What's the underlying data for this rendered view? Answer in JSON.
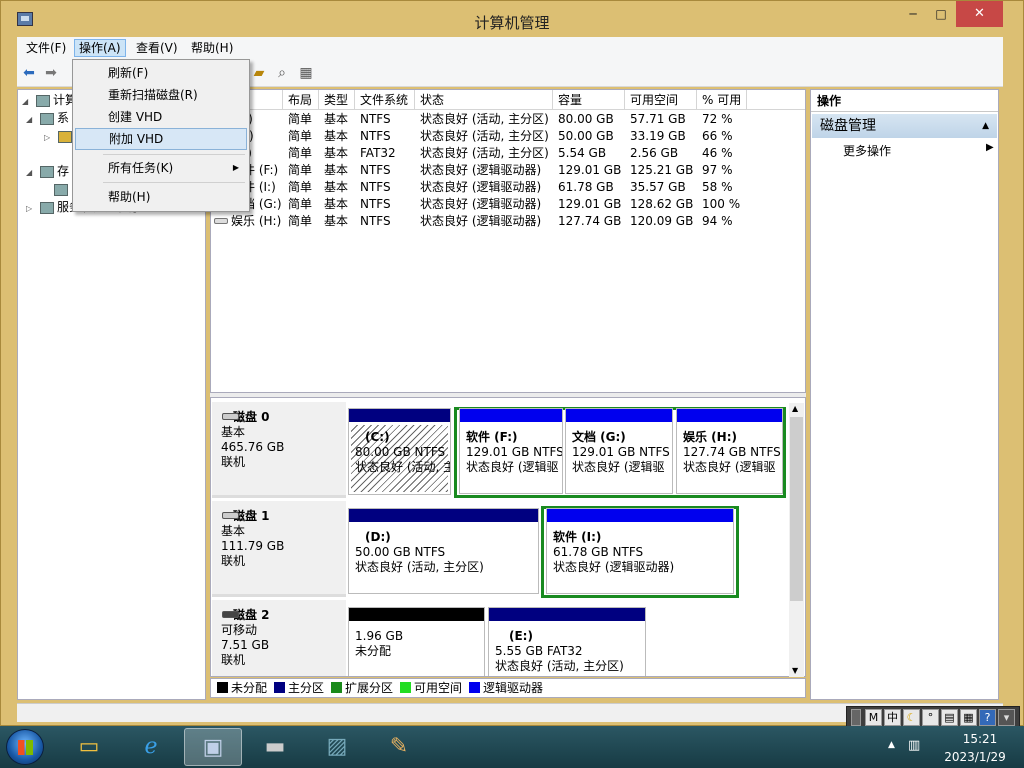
{
  "window": {
    "title": "计算机管理",
    "min": "─",
    "max": "□",
    "close": "✕"
  },
  "menubar": [
    "文件(F)",
    "操作(A)",
    "查看(V)",
    "帮助(H)"
  ],
  "dropdown": {
    "items": [
      "刷新(F)",
      "重新扫描磁盘(R)",
      "创建 VHD",
      "附加 VHD",
      "所有任务(K)",
      "帮助(H)"
    ],
    "highlighted": "附加 VHD",
    "submenu_arrow": "▶"
  },
  "tree": {
    "root": "计算机",
    "items": [
      "系",
      "",
      "存",
      "",
      "服务和应用程序"
    ]
  },
  "volumes": {
    "headers": [
      "卷",
      "布局",
      "类型",
      "文件系统",
      "状态",
      "容量",
      "可用空间",
      "% 可用"
    ],
    "rows": [
      [
        "(C:)",
        "简单",
        "基本",
        "NTFS",
        "状态良好 (活动, 主分区)",
        "80.00 GB",
        "57.71 GB",
        "72 %"
      ],
      [
        "(D:)",
        "简单",
        "基本",
        "NTFS",
        "状态良好 (活动, 主分区)",
        "50.00 GB",
        "33.19 GB",
        "66 %"
      ],
      [
        "(E:)",
        "简单",
        "基本",
        "FAT32",
        "状态良好 (活动, 主分区)",
        "5.54 GB",
        "2.56 GB",
        "46 %"
      ],
      [
        "软件 (F:)",
        "简单",
        "基本",
        "NTFS",
        "状态良好 (逻辑驱动器)",
        "129.01 GB",
        "125.21 GB",
        "97 %"
      ],
      [
        "软件 (I:)",
        "简单",
        "基本",
        "NTFS",
        "状态良好 (逻辑驱动器)",
        "61.78 GB",
        "35.57 GB",
        "58 %"
      ],
      [
        "文档 (G:)",
        "简单",
        "基本",
        "NTFS",
        "状态良好 (逻辑驱动器)",
        "129.01 GB",
        "128.62 GB",
        "100 %"
      ],
      [
        "娱乐 (H:)",
        "简单",
        "基本",
        "NTFS",
        "状态良好 (逻辑驱动器)",
        "127.74 GB",
        "120.09 GB",
        "94 %"
      ]
    ]
  },
  "disks": [
    {
      "name": "磁盘 0",
      "type": "基本",
      "size": "465.76 GB",
      "state": "联机"
    },
    {
      "name": "磁盘 1",
      "type": "基本",
      "size": "111.79 GB",
      "state": "联机"
    },
    {
      "name": "磁盘 2",
      "type": "可移动",
      "size": "7.51 GB",
      "state": "联机"
    }
  ],
  "partitions": {
    "c": {
      "label": "(C:)",
      "size": "80.00 GB NTFS",
      "status": "状态良好 (活动, 主"
    },
    "f": {
      "label": "软件  (F:)",
      "size": "129.01 GB NTFS",
      "status": "状态良好 (逻辑驱"
    },
    "g": {
      "label": "文档  (G:)",
      "size": "129.01 GB NTFS",
      "status": "状态良好 (逻辑驱"
    },
    "h": {
      "label": "娱乐  (H:)",
      "size": "127.74 GB NTFS",
      "status": "状态良好 (逻辑驱"
    },
    "d": {
      "label": "(D:)",
      "size": "50.00 GB NTFS",
      "status": "状态良好 (活动, 主分区)"
    },
    "i": {
      "label": "软件  (I:)",
      "size": "61.78 GB NTFS",
      "status": "状态良好 (逻辑驱动器)"
    },
    "unalloc": {
      "size": "1.96 GB",
      "status": "未分配"
    },
    "e": {
      "label": "(E:)",
      "size": "5.55 GB FAT32",
      "status": "状态良好 (活动, 主分区)"
    }
  },
  "legend": [
    {
      "label": "未分配",
      "color": "#000000"
    },
    {
      "label": "主分区",
      "color": "#000080"
    },
    {
      "label": "扩展分区",
      "color": "#1a8a1a"
    },
    {
      "label": "可用空间",
      "color": "#22dd22"
    },
    {
      "label": "逻辑驱动器",
      "color": "#0000ee"
    }
  ],
  "actions": {
    "header": "操作",
    "section": "磁盘管理",
    "more": "更多操作"
  },
  "tray": {
    "time": "15:21",
    "date": "2023/1/29",
    "ime": [
      "M",
      "中"
    ]
  },
  "taskbar": {
    "apps": [
      "file-explorer",
      "internet-explorer",
      "computer-management",
      "removable-drive",
      "photo-viewer",
      "paint"
    ]
  }
}
